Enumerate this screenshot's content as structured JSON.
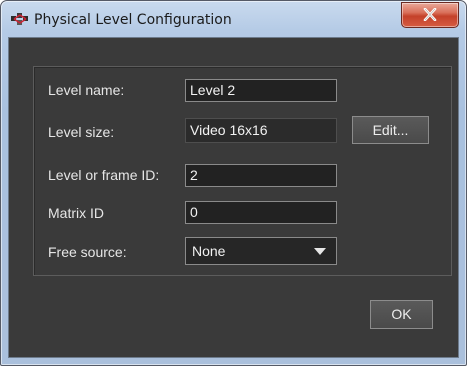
{
  "window": {
    "title": "Physical Level Configuration",
    "app_icon": "network-app-icon",
    "close_icon": "close-x-icon"
  },
  "form": {
    "level_name": {
      "label": "Level name:",
      "value": "Level 2"
    },
    "level_size": {
      "label": "Level size:",
      "value": "Video 16x16",
      "edit_label": "Edit..."
    },
    "level_frame_id": {
      "label": "Level or frame ID:",
      "value": "2"
    },
    "matrix_id": {
      "label": "Matrix ID",
      "value": "0"
    },
    "free_source": {
      "label": "Free source:",
      "value": "None",
      "icon": "dropdown-arrow-icon"
    }
  },
  "footer": {
    "ok_label": "OK"
  },
  "colors": {
    "client_background": "#3a3a3a",
    "titlebar": "#b5cbe6",
    "close_button": "#c4412a",
    "text": "#e6e6e6"
  }
}
